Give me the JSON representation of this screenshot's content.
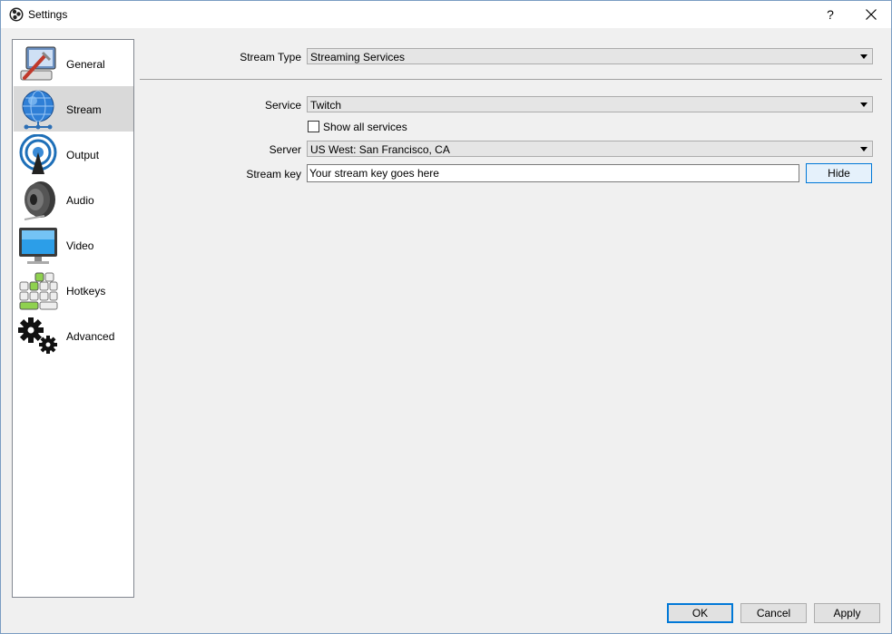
{
  "window": {
    "title": "Settings",
    "help": "?"
  },
  "sidebar": {
    "items": [
      {
        "label": "General",
        "icon": "general-icon"
      },
      {
        "label": "Stream",
        "icon": "globe-network-icon",
        "selected": true
      },
      {
        "label": "Output",
        "icon": "broadcast-antenna-icon"
      },
      {
        "label": "Audio",
        "icon": "speaker-icon"
      },
      {
        "label": "Video",
        "icon": "monitor-icon"
      },
      {
        "label": "Hotkeys",
        "icon": "keyboard-icon"
      },
      {
        "label": "Advanced",
        "icon": "gears-icon"
      }
    ]
  },
  "stream": {
    "stream_type_label": "Stream Type",
    "stream_type_value": "Streaming Services",
    "service_label": "Service",
    "service_value": "Twitch",
    "show_all_label": "Show all services",
    "show_all_checked": false,
    "server_label": "Server",
    "server_value": "US West: San Francisco, CA",
    "key_label": "Stream key",
    "key_value": "Your stream key goes here",
    "hide_label": "Hide"
  },
  "footer": {
    "ok": "OK",
    "cancel": "Cancel",
    "apply": "Apply"
  },
  "colors": {
    "accent": "#0078d7",
    "selection": "#d9d9d9"
  }
}
